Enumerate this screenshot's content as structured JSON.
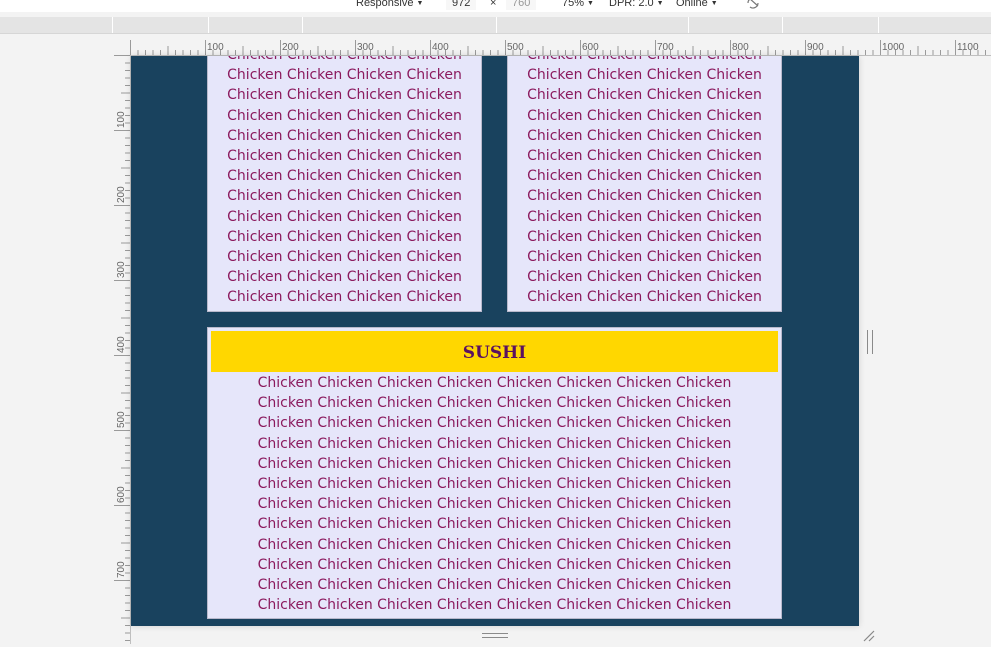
{
  "device_toolbar": {
    "device": "Responsive",
    "width": "972",
    "separator": "×",
    "height": "760",
    "zoom": "75%",
    "dpr": "DPR: 2.0",
    "network": "Online",
    "rotate_icon": "rotate-icon"
  },
  "ruler_top_labels": [
    "100",
    "200",
    "300",
    "400",
    "500",
    "600",
    "700",
    "800",
    "900",
    "1000",
    "1100"
  ],
  "ruler_left_labels": [
    "100",
    "200",
    "300",
    "400",
    "500",
    "600",
    "700"
  ],
  "page": {
    "card1_text": "Chicken Chicken Chicken Chicken Chicken Chicken Chicken Chicken Chicken Chicken Chicken Chicken Chicken Chicken Chicken Chicken Chicken Chicken Chicken Chicken Chicken Chicken Chicken Chicken Chicken Chicken Chicken Chicken Chicken Chicken Chicken Chicken Chicken Chicken Chicken Chicken Chicken Chicken Chicken Chicken Chicken Chicken Chicken Chicken Chicken Chicken Chicken Chicken Chicken Chicken Chicken Chicken Chicken",
    "card2_text": "Chicken Chicken Chicken Chicken Chicken Chicken Chicken Chicken Chicken Chicken Chicken Chicken Chicken Chicken Chicken Chicken Chicken Chicken Chicken Chicken Chicken Chicken Chicken Chicken Chicken Chicken Chicken Chicken Chicken Chicken Chicken Chicken Chicken Chicken Chicken Chicken Chicken Chicken Chicken Chicken Chicken Chicken Chicken Chicken Chicken Chicken Chicken Chicken Chicken Chicken Chicken Chicken Chicken",
    "sushi_title": "SUSHI",
    "sushi_text": "Chicken Chicken Chicken Chicken Chicken Chicken Chicken Chicken Chicken Chicken Chicken Chicken Chicken Chicken Chicken Chicken Chicken Chicken Chicken Chicken Chicken Chicken Chicken Chicken Chicken Chicken Chicken Chicken Chicken Chicken Chicken Chicken Chicken Chicken Chicken Chicken Chicken Chicken Chicken Chicken Chicken Chicken Chicken Chicken Chicken Chicken Chicken Chicken Chicken Chicken Chicken Chicken Chicken Chicken Chicken Chicken Chicken Chicken Chicken Chicken Chicken Chicken Chicken Chicken Chicken Chicken Chicken Chicken Chicken Chicken Chicken Chicken Chicken Chicken Chicken Chicken Chicken Chicken Chicken Chicken Chicken Chicken Chicken Chicken Chicken Chicken Chicken Chicken Chicken Chicken Chicken Chicken Chicken Chicken Chicken Chicken Chicken Chicken Chicken Chicken Chicken Chicken Chicken Chicken Chicken Chicken Chicken Chicken Chicken"
  },
  "colors": {
    "page_background": "#19425e",
    "card_background": "#e6e6fa",
    "card_text": "#8b1a5e",
    "title_background": "#ffd700",
    "title_text": "#5a1060"
  }
}
